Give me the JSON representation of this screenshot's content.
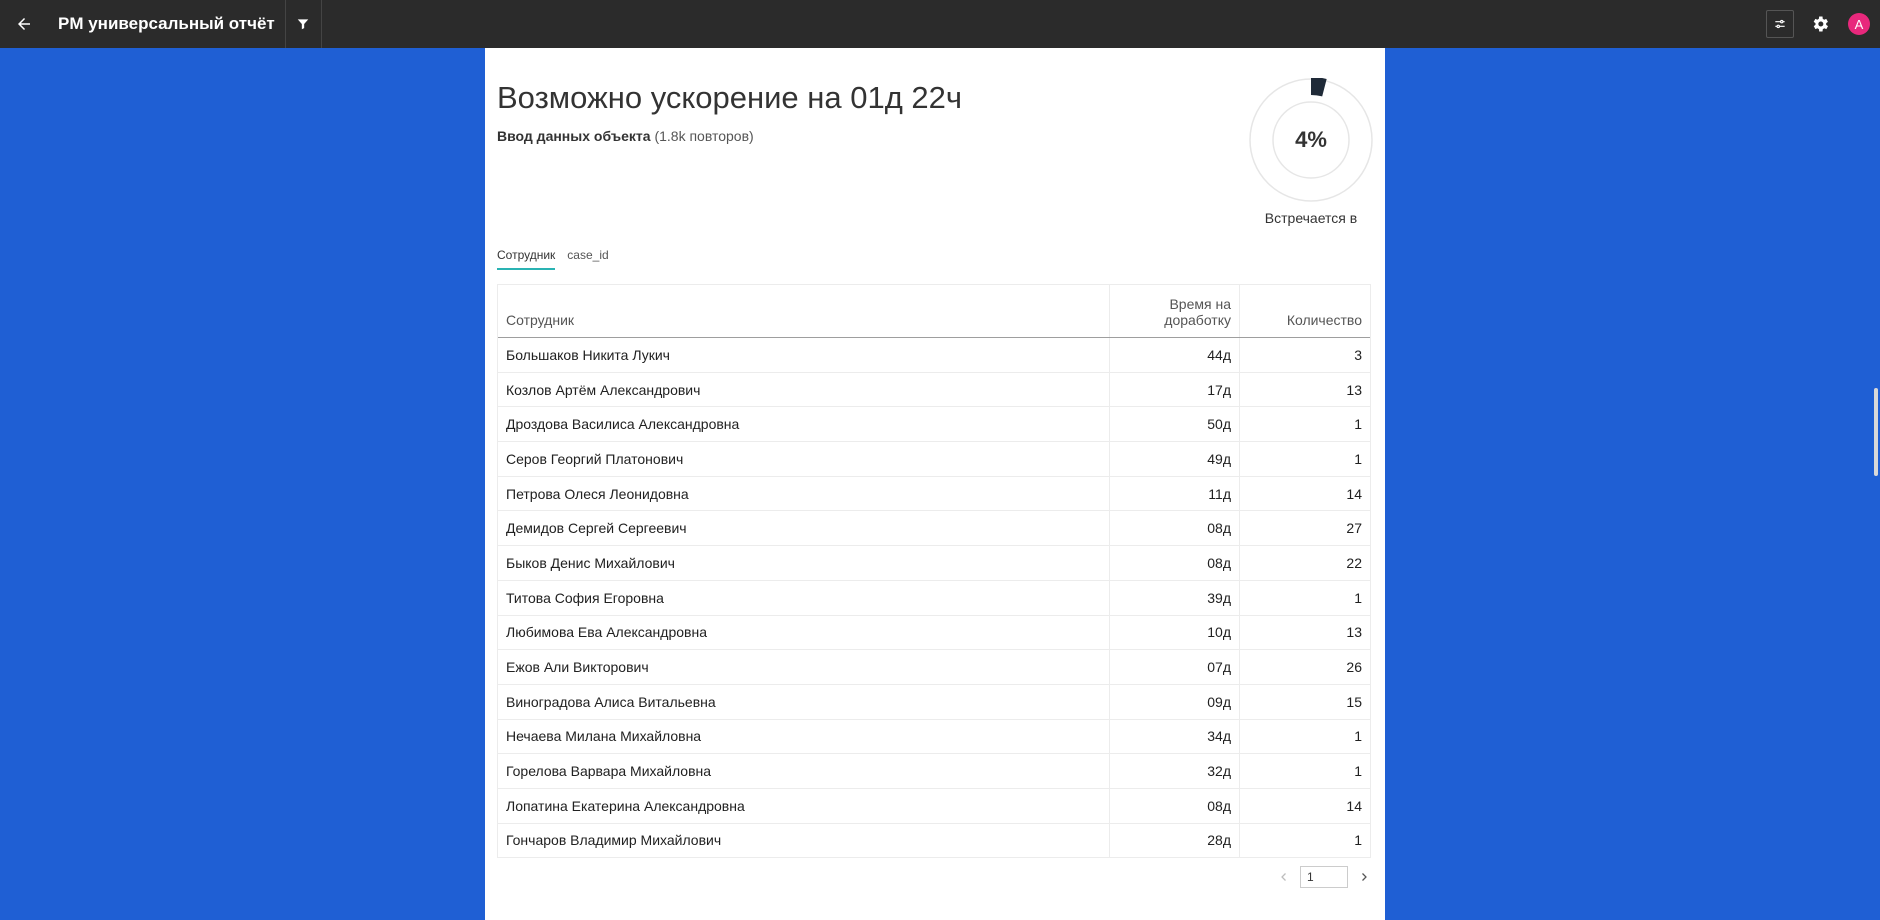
{
  "header": {
    "title": "PM универсальный отчёт",
    "avatar_letter": "A"
  },
  "colors": {
    "topbar": "#2b2b2b",
    "background": "#1f5fd4",
    "accent_tab": "#2ab3b3",
    "donut_fill": "#1f2a38",
    "avatar": "#e8287c"
  },
  "summary": {
    "title": "Возможно ускорение на 01д 22ч",
    "subtitle_bold": "Ввод данных объекта",
    "subtitle_rest": " (1.8k повторов)",
    "percent_label": "4%",
    "percent_value": 4,
    "caption": "Встречается в"
  },
  "tabs": [
    {
      "label": "Сотрудник",
      "active": true
    },
    {
      "label": "case_id",
      "active": false
    }
  ],
  "table": {
    "headers": [
      "Сотрудник",
      "Время на доработку",
      "Количество"
    ],
    "rows": [
      [
        "Большаков Никита Лукич",
        "44д",
        "3"
      ],
      [
        "Козлов Артём Александрович",
        "17д",
        "13"
      ],
      [
        "Дроздова Василиса Александровна",
        "50д",
        "1"
      ],
      [
        "Серов Георгий Платонович",
        "49д",
        "1"
      ],
      [
        "Петрова Олеся Леонидовна",
        "11д",
        "14"
      ],
      [
        "Демидов Сергей Сергеевич",
        "08д",
        "27"
      ],
      [
        "Быков Денис Михайлович",
        "08д",
        "22"
      ],
      [
        "Титова София Егоровна",
        "39д",
        "1"
      ],
      [
        "Любимова Ева Александровна",
        "10д",
        "13"
      ],
      [
        "Ежов Али Викторович",
        "07д",
        "26"
      ],
      [
        "Виноградова Алиса Витальевна",
        "09д",
        "15"
      ],
      [
        "Нечаева Милана Михайловна",
        "34д",
        "1"
      ],
      [
        "Горелова Варвара Михайловна",
        "32д",
        "1"
      ],
      [
        "Лопатина Екатерина Александровна",
        "08д",
        "14"
      ],
      [
        "Гончаров Владимир Михайлович",
        "28д",
        "1"
      ]
    ]
  },
  "pagination": {
    "current_page": "1"
  }
}
